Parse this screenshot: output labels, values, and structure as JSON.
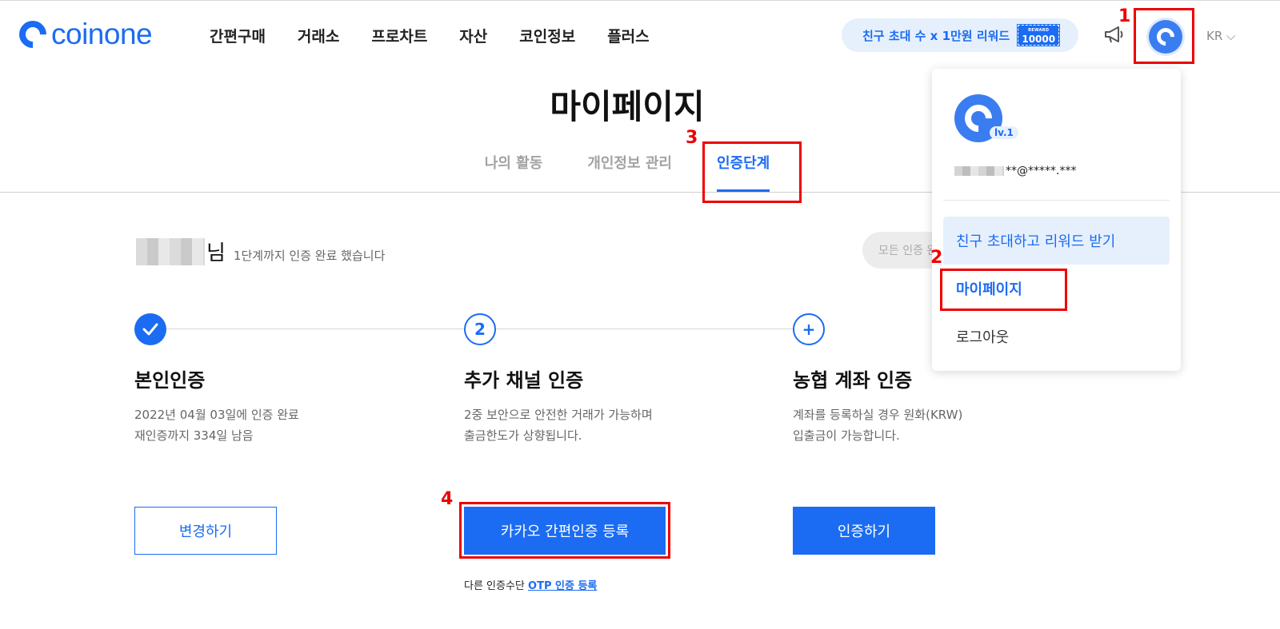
{
  "brand": {
    "name": "coinone"
  },
  "nav": {
    "items": [
      {
        "label": "간편구매"
      },
      {
        "label": "거래소"
      },
      {
        "label": "프로차트"
      },
      {
        "label": "자산"
      },
      {
        "label": "코인정보"
      },
      {
        "label": "플러스"
      }
    ]
  },
  "header": {
    "invite_text": "친구 초대 수 x 1만원 리워드",
    "reward_badge_top": "REWARD",
    "reward_badge_value": "10000",
    "language": "KR ⌵"
  },
  "page": {
    "title": "마이페이지",
    "tabs": [
      {
        "label": "나의 활동"
      },
      {
        "label": "개인정보 관리"
      },
      {
        "label": "인증단계",
        "active": true
      }
    ]
  },
  "greeting": {
    "suffix": "님",
    "subtitle": "1단계까지 인증 완료 했습니다",
    "all_pill": "모든 인증 완"
  },
  "steps": [
    {
      "marker": "",
      "title": "본인인증",
      "desc_line1": "2022년 04월 03일에 인증 완료",
      "desc_line2": "재인증까지 334일 남음",
      "button": "변경하기"
    },
    {
      "marker": "2",
      "title": "추가 채널 인증",
      "desc_line1": "2중 보안으로 안전한 거래가 가능하며",
      "desc_line2": "출금한도가 상향됩니다.",
      "button": "카카오 간편인증 등록",
      "alt_prefix": "다른 인증수단",
      "alt_link": "OTP 인증 등록"
    },
    {
      "marker": "+",
      "title": "농협 계좌 인증",
      "desc_line1": "계좌를 등록하실 경우 원화(KRW)",
      "desc_line2": "입출금이 가능합니다.",
      "button": "인증하기"
    }
  ],
  "dropdown": {
    "level": "lv.1",
    "email_masked": "**@*****.***",
    "invite_item": "친구 초대하고 리워드 받기",
    "mypage_item": "마이페이지",
    "logout_item": "로그아웃"
  },
  "annotations": {
    "n1": "1",
    "n2": "2",
    "n3": "3",
    "n4": "4"
  },
  "colors": {
    "accent": "#1b6cf2",
    "annotation": "#e00000",
    "pill_bg": "#e6f0fd"
  }
}
